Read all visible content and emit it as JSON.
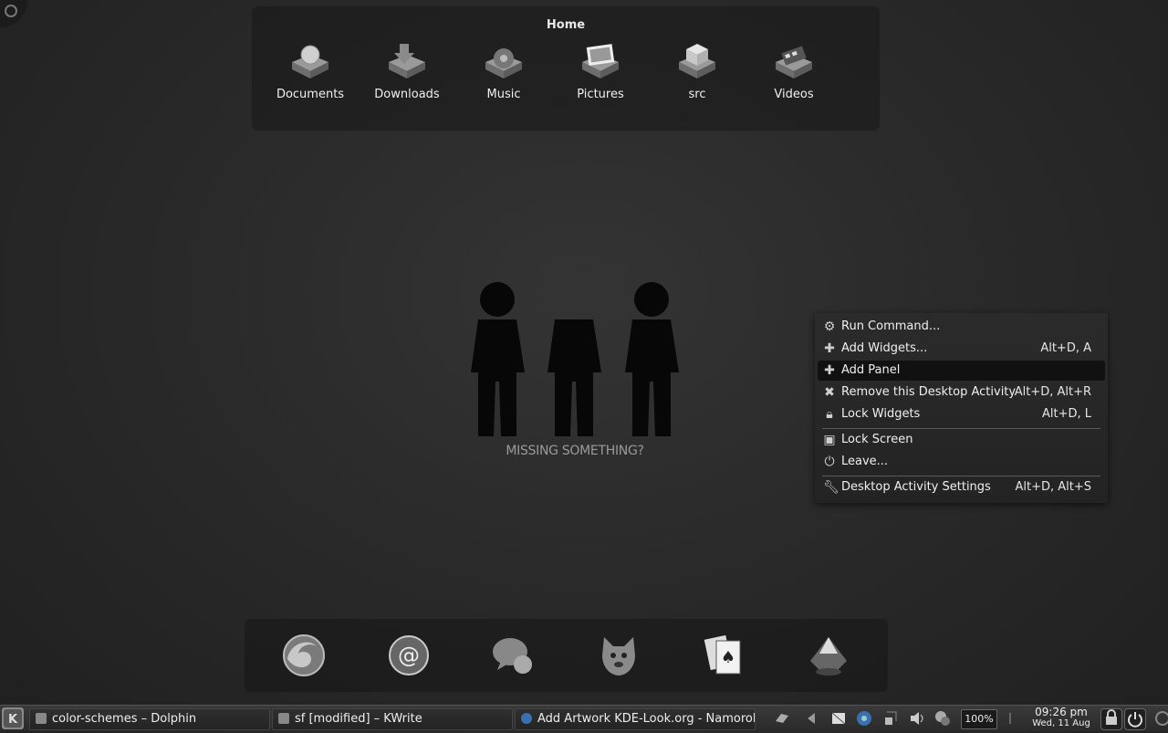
{
  "folder_view": {
    "title": "Home",
    "items": [
      {
        "label": "Documents",
        "icon": "documents-folder-icon"
      },
      {
        "label": "Downloads",
        "icon": "downloads-folder-icon"
      },
      {
        "label": "Music",
        "icon": "music-folder-icon"
      },
      {
        "label": "Pictures",
        "icon": "pictures-folder-icon"
      },
      {
        "label": "src",
        "icon": "src-folder-icon"
      },
      {
        "label": "Videos",
        "icon": "videos-folder-icon"
      }
    ]
  },
  "wallpaper": {
    "text": "MISSING SOMETHING?"
  },
  "context_menu": {
    "items": [
      {
        "label": "Run Command...",
        "shortcut": "",
        "icon": "run-command-icon"
      },
      {
        "label": "Add Widgets...",
        "shortcut": "Alt+D, A",
        "icon": "add-icon"
      },
      {
        "label": "Add Panel",
        "shortcut": "",
        "icon": "add-icon"
      },
      {
        "label": "Remove this Desktop Activity",
        "shortcut": "Alt+D, Alt+R",
        "icon": "remove-icon"
      },
      {
        "label": "Lock Widgets",
        "shortcut": "Alt+D, L",
        "icon": "lock-icon"
      },
      {
        "label": "Lock Screen",
        "shortcut": "",
        "icon": "lock-screen-icon"
      },
      {
        "label": "Leave...",
        "shortcut": "",
        "icon": "leave-icon"
      },
      {
        "label": "Desktop Activity Settings",
        "shortcut": "Alt+D, Alt+S",
        "icon": "settings-wrench-icon"
      }
    ]
  },
  "dock": {
    "icons": [
      "firefox-icon",
      "mail-icon",
      "chat-icon",
      "gimp-icon",
      "cards-game-icon",
      "inkscape-icon"
    ]
  },
  "taskbar": {
    "tasks": [
      {
        "label": "color-schemes – Dolphin"
      },
      {
        "label": "sf [modified] – KWrite"
      },
      {
        "label": "Add Artwork KDE-Look.org - Namoroka"
      }
    ],
    "battery": "100%",
    "time": "09:26 pm",
    "date": "Wed, 11 Aug"
  }
}
